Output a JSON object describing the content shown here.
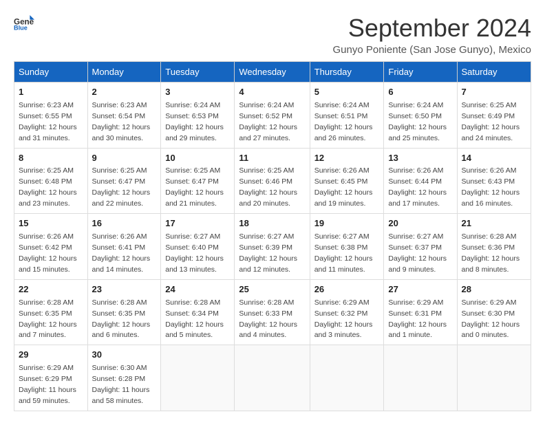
{
  "logo": {
    "general": "General",
    "blue": "Blue"
  },
  "title": "September 2024",
  "subtitle": "Gunyo Poniente (San Jose Gunyo), Mexico",
  "days_of_week": [
    "Sunday",
    "Monday",
    "Tuesday",
    "Wednesday",
    "Thursday",
    "Friday",
    "Saturday"
  ],
  "weeks": [
    [
      {
        "day": "1",
        "sunrise": "6:23 AM",
        "sunset": "6:55 PM",
        "daylight": "12 hours and 31 minutes."
      },
      {
        "day": "2",
        "sunrise": "6:23 AM",
        "sunset": "6:54 PM",
        "daylight": "12 hours and 30 minutes."
      },
      {
        "day": "3",
        "sunrise": "6:24 AM",
        "sunset": "6:53 PM",
        "daylight": "12 hours and 29 minutes."
      },
      {
        "day": "4",
        "sunrise": "6:24 AM",
        "sunset": "6:52 PM",
        "daylight": "12 hours and 27 minutes."
      },
      {
        "day": "5",
        "sunrise": "6:24 AM",
        "sunset": "6:51 PM",
        "daylight": "12 hours and 26 minutes."
      },
      {
        "day": "6",
        "sunrise": "6:24 AM",
        "sunset": "6:50 PM",
        "daylight": "12 hours and 25 minutes."
      },
      {
        "day": "7",
        "sunrise": "6:25 AM",
        "sunset": "6:49 PM",
        "daylight": "12 hours and 24 minutes."
      }
    ],
    [
      {
        "day": "8",
        "sunrise": "6:25 AM",
        "sunset": "6:48 PM",
        "daylight": "12 hours and 23 minutes."
      },
      {
        "day": "9",
        "sunrise": "6:25 AM",
        "sunset": "6:47 PM",
        "daylight": "12 hours and 22 minutes."
      },
      {
        "day": "10",
        "sunrise": "6:25 AM",
        "sunset": "6:47 PM",
        "daylight": "12 hours and 21 minutes."
      },
      {
        "day": "11",
        "sunrise": "6:25 AM",
        "sunset": "6:46 PM",
        "daylight": "12 hours and 20 minutes."
      },
      {
        "day": "12",
        "sunrise": "6:26 AM",
        "sunset": "6:45 PM",
        "daylight": "12 hours and 19 minutes."
      },
      {
        "day": "13",
        "sunrise": "6:26 AM",
        "sunset": "6:44 PM",
        "daylight": "12 hours and 17 minutes."
      },
      {
        "day": "14",
        "sunrise": "6:26 AM",
        "sunset": "6:43 PM",
        "daylight": "12 hours and 16 minutes."
      }
    ],
    [
      {
        "day": "15",
        "sunrise": "6:26 AM",
        "sunset": "6:42 PM",
        "daylight": "12 hours and 15 minutes."
      },
      {
        "day": "16",
        "sunrise": "6:26 AM",
        "sunset": "6:41 PM",
        "daylight": "12 hours and 14 minutes."
      },
      {
        "day": "17",
        "sunrise": "6:27 AM",
        "sunset": "6:40 PM",
        "daylight": "12 hours and 13 minutes."
      },
      {
        "day": "18",
        "sunrise": "6:27 AM",
        "sunset": "6:39 PM",
        "daylight": "12 hours and 12 minutes."
      },
      {
        "day": "19",
        "sunrise": "6:27 AM",
        "sunset": "6:38 PM",
        "daylight": "12 hours and 11 minutes."
      },
      {
        "day": "20",
        "sunrise": "6:27 AM",
        "sunset": "6:37 PM",
        "daylight": "12 hours and 9 minutes."
      },
      {
        "day": "21",
        "sunrise": "6:28 AM",
        "sunset": "6:36 PM",
        "daylight": "12 hours and 8 minutes."
      }
    ],
    [
      {
        "day": "22",
        "sunrise": "6:28 AM",
        "sunset": "6:35 PM",
        "daylight": "12 hours and 7 minutes."
      },
      {
        "day": "23",
        "sunrise": "6:28 AM",
        "sunset": "6:35 PM",
        "daylight": "12 hours and 6 minutes."
      },
      {
        "day": "24",
        "sunrise": "6:28 AM",
        "sunset": "6:34 PM",
        "daylight": "12 hours and 5 minutes."
      },
      {
        "day": "25",
        "sunrise": "6:28 AM",
        "sunset": "6:33 PM",
        "daylight": "12 hours and 4 minutes."
      },
      {
        "day": "26",
        "sunrise": "6:29 AM",
        "sunset": "6:32 PM",
        "daylight": "12 hours and 3 minutes."
      },
      {
        "day": "27",
        "sunrise": "6:29 AM",
        "sunset": "6:31 PM",
        "daylight": "12 hours and 1 minute."
      },
      {
        "day": "28",
        "sunrise": "6:29 AM",
        "sunset": "6:30 PM",
        "daylight": "12 hours and 0 minutes."
      }
    ],
    [
      {
        "day": "29",
        "sunrise": "6:29 AM",
        "sunset": "6:29 PM",
        "daylight": "11 hours and 59 minutes."
      },
      {
        "day": "30",
        "sunrise": "6:30 AM",
        "sunset": "6:28 PM",
        "daylight": "11 hours and 58 minutes."
      },
      null,
      null,
      null,
      null,
      null
    ]
  ]
}
